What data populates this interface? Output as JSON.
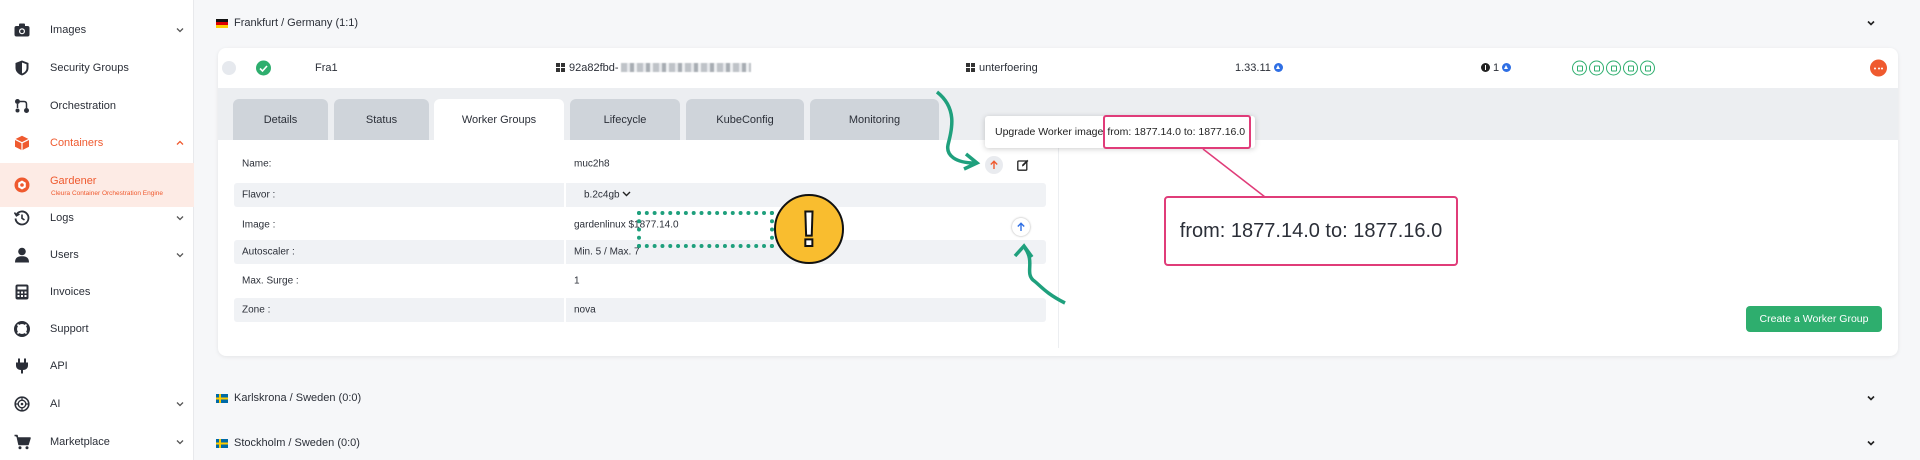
{
  "sidebar": {
    "items": [
      {
        "label": "Images",
        "icon": "camera-icon",
        "chevron": true
      },
      {
        "label": "Security Groups",
        "icon": "shield-icon",
        "chevron": false
      },
      {
        "label": "Orchestration",
        "icon": "orchestration-icon",
        "chevron": false
      },
      {
        "label": "Containers",
        "icon": "cube-icon",
        "chevron": true,
        "expanded": true
      },
      {
        "label": "Gardener",
        "sub": "Cleura Container Orchestration Engine",
        "icon": "gardener-icon",
        "selected": true
      },
      {
        "label": "Logs",
        "icon": "history-icon",
        "chevron": true
      },
      {
        "label": "Users",
        "icon": "user-icon",
        "chevron": true
      },
      {
        "label": "Invoices",
        "icon": "calculator-icon",
        "chevron": false
      },
      {
        "label": "Support",
        "icon": "lifebuoy-icon",
        "chevron": false
      },
      {
        "label": "API",
        "icon": "plug-icon",
        "chevron": false
      },
      {
        "label": "AI",
        "icon": "ai-icon",
        "chevron": true
      },
      {
        "label": "Marketplace",
        "icon": "cart-icon",
        "chevron": true
      }
    ]
  },
  "regions": {
    "frankfurt": "Frankfurt / Germany (1:1)",
    "karlskrona": "Karlskrona / Sweden (0:0)",
    "stockholm": "Stockholm / Sweden (0:0)"
  },
  "cluster": {
    "name": "Fra1",
    "id_prefix": "92a82fbd-",
    "project": "unterfoering",
    "k8s_version": "1.33.11",
    "info_count": "1"
  },
  "tabs": [
    "Details",
    "Status",
    "Worker Groups",
    "Lifecycle",
    "KubeConfig",
    "Monitoring"
  ],
  "active_tab": "Worker Groups",
  "worker_group": {
    "rows": [
      {
        "key": "Name:",
        "value": "muc2h8"
      },
      {
        "key": "Flavor :",
        "value": "b.2c4gb"
      },
      {
        "key": "Image :",
        "value": "gardenlinux $1877.14.0"
      },
      {
        "key": "Autoscaler :",
        "value": "Min. 5 / Max. 7"
      },
      {
        "key": "Max. Surge :",
        "value": "1"
      },
      {
        "key": "Zone :",
        "value": "nova"
      }
    ]
  },
  "tooltip": {
    "prefix": "Upgrade Worker image",
    "versions": "from: 1877.14.0 to: 1877.16.0"
  },
  "zoom_callout": "from: 1877.14.0 to: 1877.16.0",
  "warning_symbol": "!",
  "create_button": "Create a Worker Group",
  "colors": {
    "accent": "#ef5a2f",
    "success": "#2eae6e",
    "highlight": "#1fa07d",
    "callout": "#e03c79",
    "warning": "#f9bd2f",
    "upgrade": "#2f6fe4"
  }
}
